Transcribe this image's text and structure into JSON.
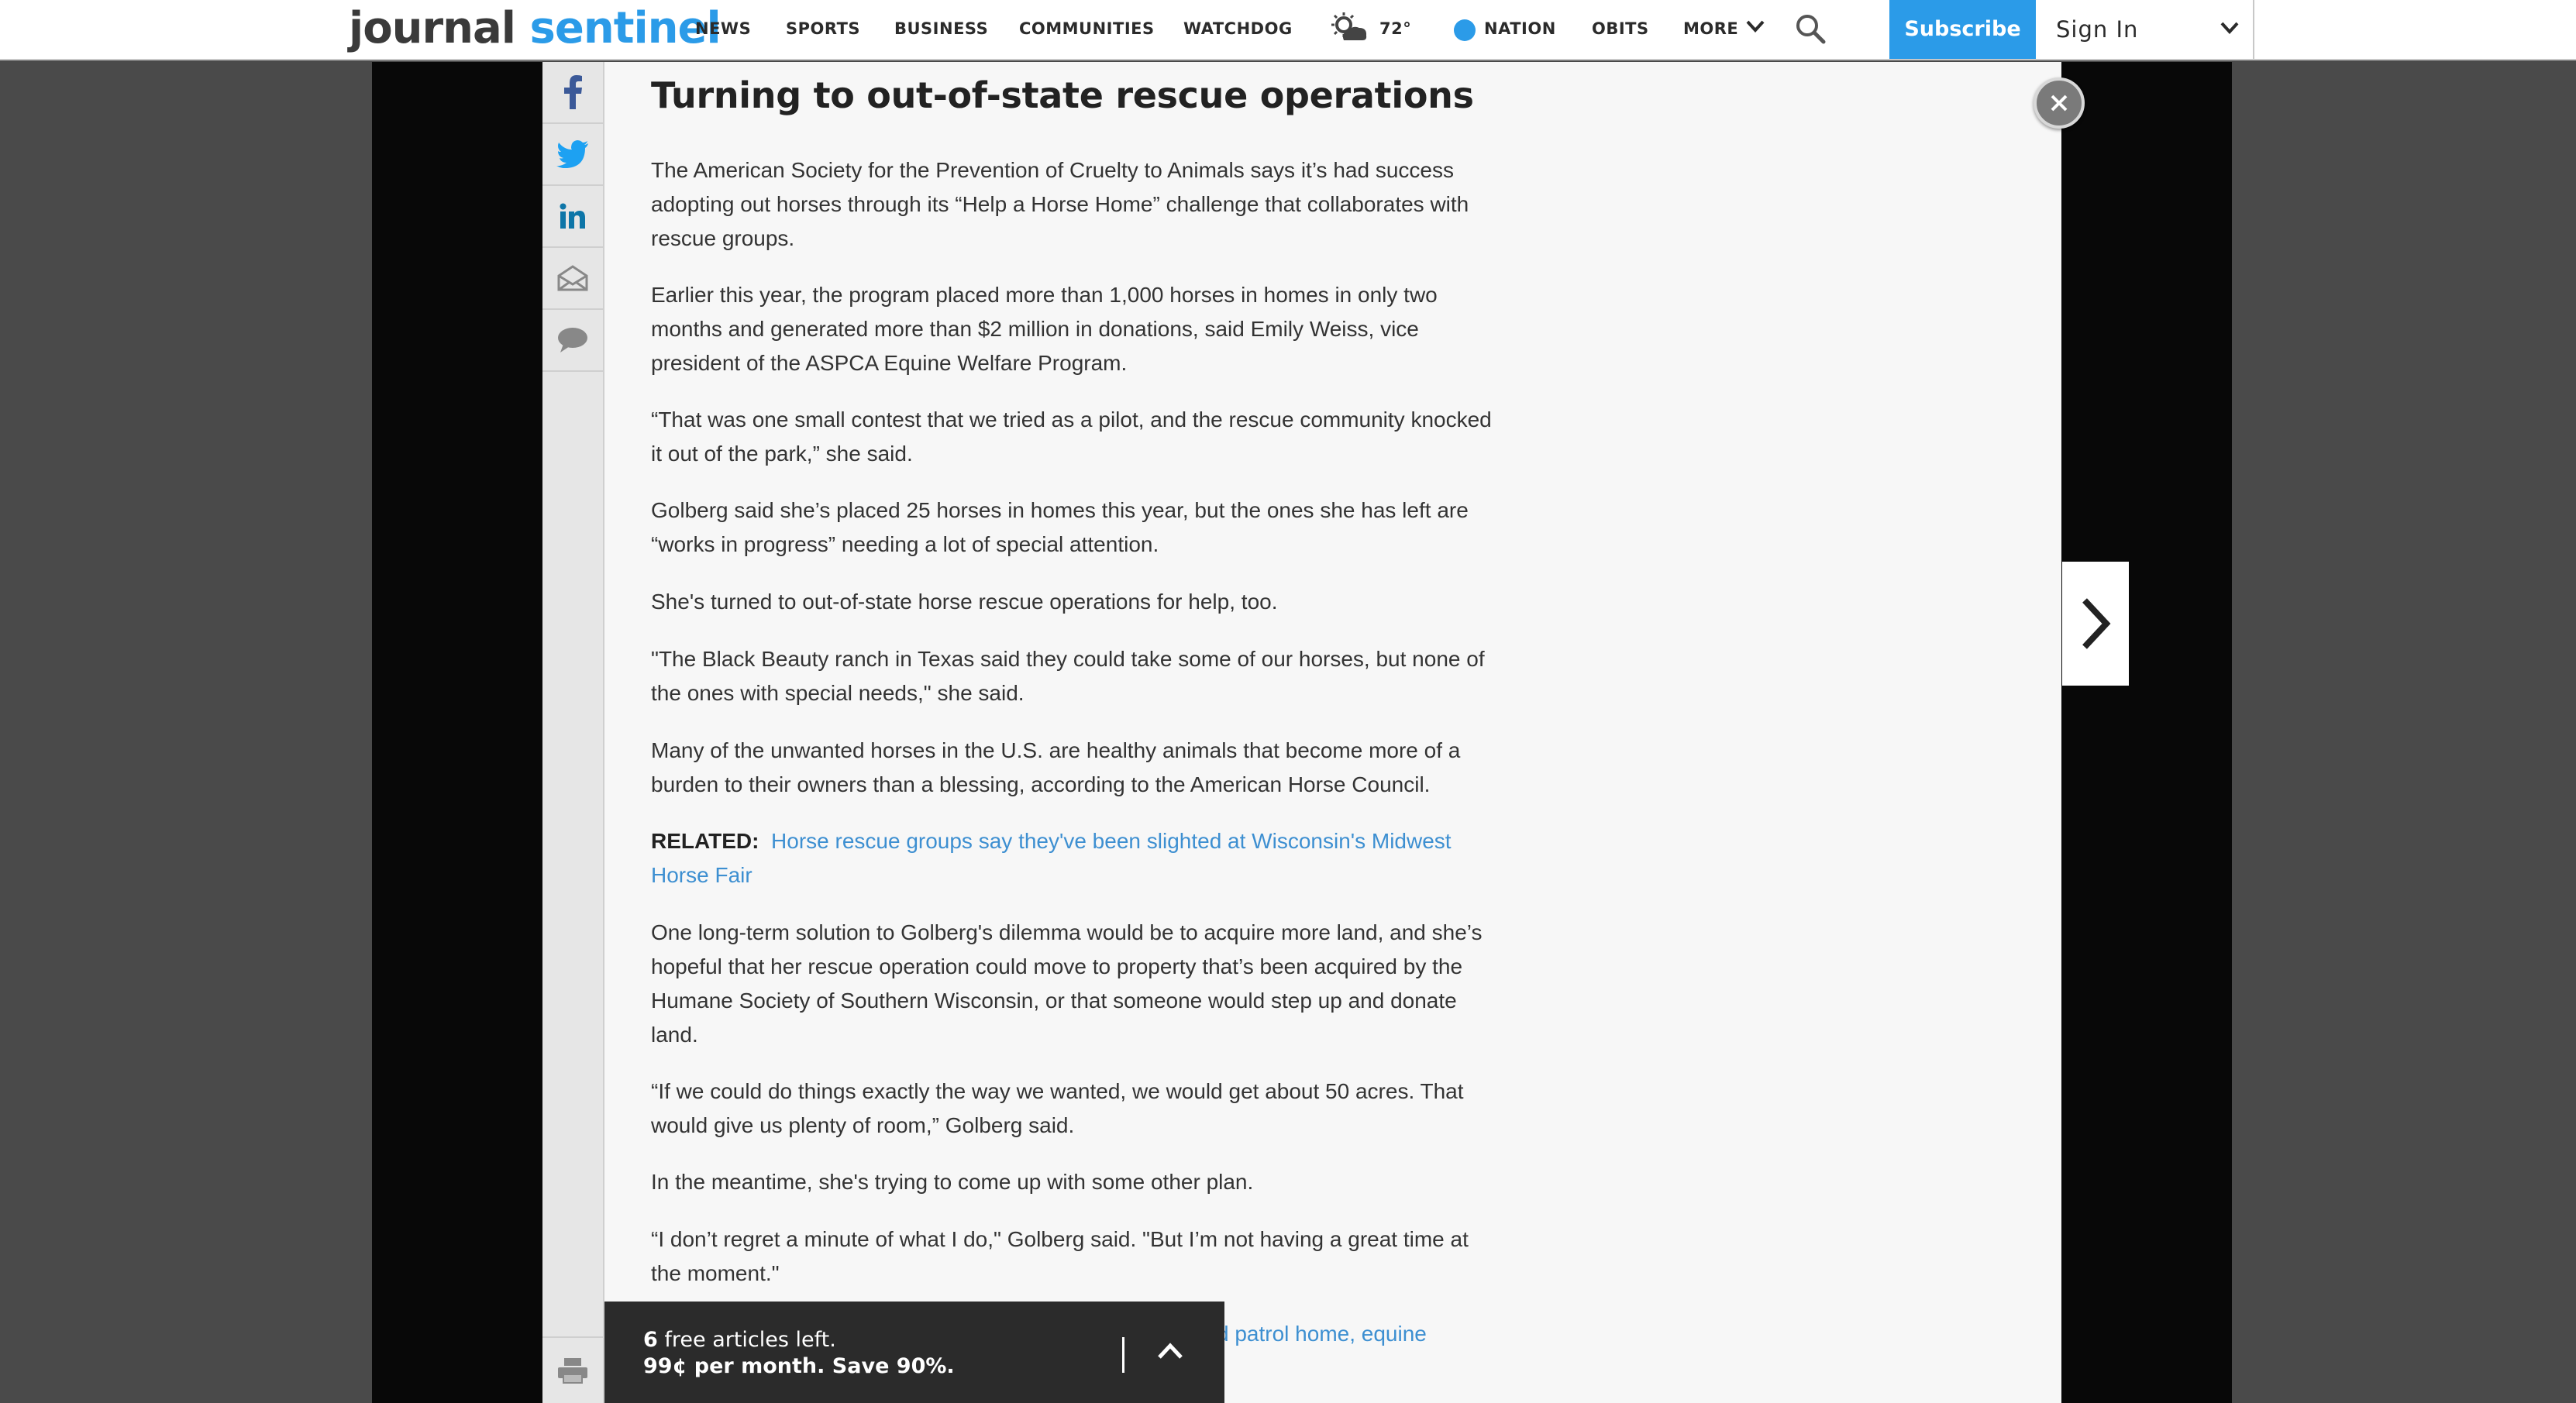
{
  "header": {
    "brand_part1": "journal",
    "brand_part2": "sentinel",
    "nav": [
      "NEWS",
      "SPORTS",
      "BUSINESS",
      "COMMUNITIES",
      "WATCHDOG"
    ],
    "weather_temp": "72°",
    "weather_icon": "partly-cloudy-icon",
    "nation": "NATION",
    "obits": "OBITS",
    "more": "MORE",
    "subscribe": "Subscribe",
    "sign_in": "Sign In"
  },
  "share_rail": {
    "icons": [
      "facebook-icon",
      "twitter-icon",
      "linkedin-icon",
      "email-icon",
      "comment-icon",
      "print-icon"
    ],
    "colors": {
      "facebook": "#3b5998",
      "twitter": "#1da1f2",
      "linkedin": "#0e76a8",
      "neutral": "#888888"
    }
  },
  "article": {
    "headline": "Turning to out-of-state rescue operations",
    "paragraphs": [
      "The American Society for the Prevention of Cruelty to Animals says it’s had success adopting out horses through its “Help a Horse Home” challenge that collaborates with rescue groups.",
      "Earlier this year, the program placed more than 1,000 horses in homes in only two months and generated more than $2 million in donations, said Emily Weiss, vice president of the ASPCA Equine Welfare Program.",
      "“That was one small contest that we tried as a pilot, and the rescue community knocked it out of the park,” she said.",
      "Golberg said she’s placed 25 horses in homes this year, but the ones she has left are “works in progress” needing a lot of special attention.",
      "She's turned to out-of-state horse rescue operations for help, too.",
      "\"The Black Beauty ranch in Texas said they could take some of our horses, but none of the ones with special needs,\" she said.",
      "Many of the unwanted horses in the U.S. are healthy animals that become more of a burden to their owners than a blessing, according to the American Horse Council."
    ],
    "related_label": "RELATED:",
    "related_link": "Horse rescue groups say they've been slighted at Wisconsin's Midwest Horse Fair",
    "paragraphs2": [
      "One long-term solution to Golberg's dilemma would be to acquire more land, and she’s hopeful that her rescue operation could move to property that’s been acquired by the Humane Society of Southern Wisconsin, or that someone would step up and donate land.",
      "“If we could do things exactly the way we wanted, we would get about 50 acres. That would give us plenty of room,” Golberg said.",
      "In the meantime, she's trying to come up with some other plan.",
      "“I don’t regret a minute of what I do,\" Golberg said. \"But I’m not having a great time at the moment.\""
    ],
    "partial_link": "d patrol home, equine"
  },
  "meter": {
    "count": "6",
    "line1_rest": " free articles left.",
    "line2": "99¢ per month. Save 90%."
  },
  "colors": {
    "accent": "#2b9be8",
    "link": "#3d8fd1",
    "overlay_dark": "#080808",
    "article_bg": "#f7f7f7"
  }
}
